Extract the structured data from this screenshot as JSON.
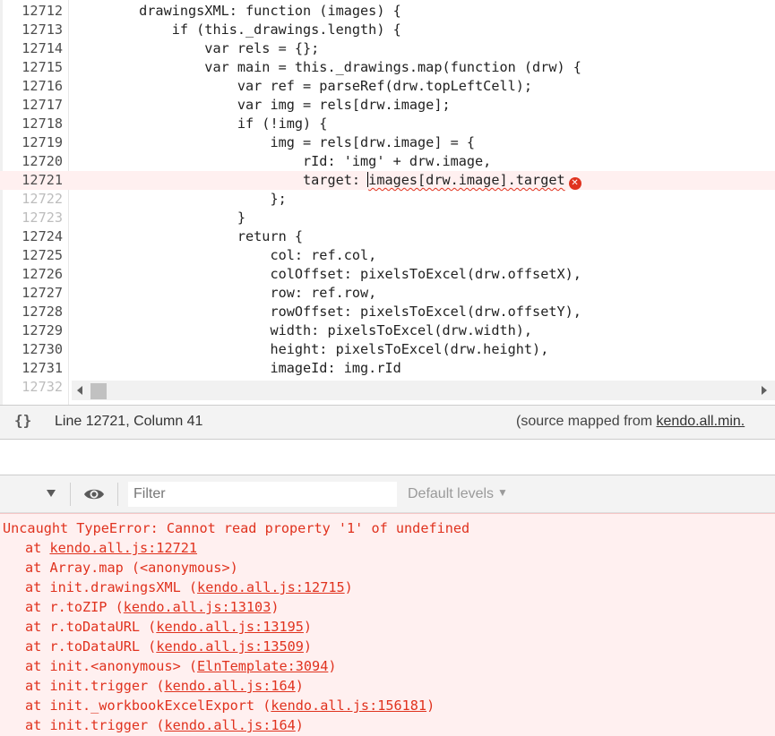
{
  "editor": {
    "lines": [
      {
        "num": "12712",
        "text": "        drawingsXML: function (images) {"
      },
      {
        "num": "12713",
        "text": "            if (this._drawings.length) {"
      },
      {
        "num": "12714",
        "text": "                var rels = {};"
      },
      {
        "num": "12715",
        "text": "                var main = this._drawings.map(function (drw) {"
      },
      {
        "num": "12716",
        "text": "                    var ref = parseRef(drw.topLeftCell);"
      },
      {
        "num": "12717",
        "text": "                    var img = rels[drw.image];"
      },
      {
        "num": "12718",
        "text": "                    if (!img) {"
      },
      {
        "num": "12719",
        "text": "                        img = rels[drw.image] = {"
      },
      {
        "num": "12720",
        "text": "                            rId: 'img' + drw.image,"
      },
      {
        "num": "12721",
        "prefix": "                            target: ",
        "error_text": "images[drw.image].target"
      },
      {
        "num": "12722",
        "text": "                        };"
      },
      {
        "num": "12723",
        "text": "                    }"
      },
      {
        "num": "12724",
        "text": "                    return {"
      },
      {
        "num": "12725",
        "text": "                        col: ref.col,"
      },
      {
        "num": "12726",
        "text": "                        colOffset: pixelsToExcel(drw.offsetX),"
      },
      {
        "num": "12727",
        "text": "                        row: ref.row,"
      },
      {
        "num": "12728",
        "text": "                        rowOffset: pixelsToExcel(drw.offsetY),"
      },
      {
        "num": "12729",
        "text": "                        width: pixelsToExcel(drw.width),"
      },
      {
        "num": "12730",
        "text": "                        height: pixelsToExcel(drw.height),"
      },
      {
        "num": "12731",
        "text": "                        imageId: img.rId"
      },
      {
        "num": "12732",
        "text": ""
      }
    ],
    "error_icon": "error-circle-icon",
    "error_color": "#e0321e"
  },
  "status": {
    "braces": "{}",
    "line_col": "Line 12721, Column 41",
    "source_prefix": "(source mapped from ",
    "source_file": "kendo.all.min."
  },
  "toolbar": {
    "filter_placeholder": "Filter",
    "levels_label": "Default levels",
    "levels_caret": "▼"
  },
  "console": {
    "error_message": "Uncaught TypeError: Cannot read property '1' of undefined",
    "frames": [
      {
        "func": "",
        "location": "kendo.all.js:12721"
      },
      {
        "func": "Array.map (<anonymous>)",
        "location": ""
      },
      {
        "func": "init.drawingsXML ",
        "location": "kendo.all.js:12715"
      },
      {
        "func": "r.toZIP ",
        "location": "kendo.all.js:13103"
      },
      {
        "func": "r.toDataURL ",
        "location": "kendo.all.js:13195"
      },
      {
        "func": "r.toDataURL ",
        "location": "kendo.all.js:13509"
      },
      {
        "func": "init.<anonymous> ",
        "location": "ElnTemplate:3094"
      },
      {
        "func": "init.trigger ",
        "location": "kendo.all.js:164"
      },
      {
        "func": "init._workbookExcelExport ",
        "location": "kendo.all.js:156181"
      },
      {
        "func": "init.trigger ",
        "location": "kendo.all.js:164"
      }
    ]
  }
}
